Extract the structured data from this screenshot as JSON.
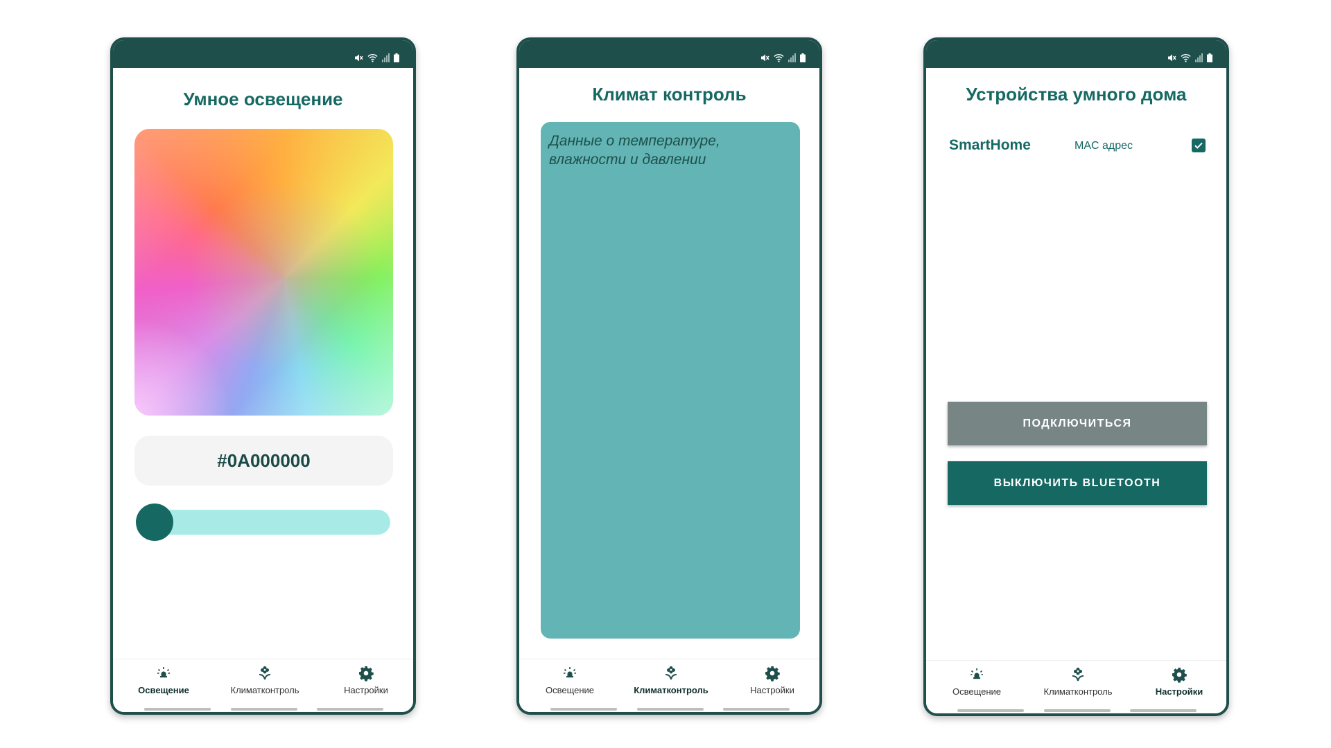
{
  "colors": {
    "primary": "#166963",
    "status_bar": "#1e4f4b",
    "climate_panel": "#62b5b4",
    "slider_track": "#a8ebe6",
    "connect_button": "#778584"
  },
  "nav": {
    "items": [
      {
        "label": "Освещение",
        "icon": "bulb-icon"
      },
      {
        "label": "Климатконтроль",
        "icon": "flower-icon"
      },
      {
        "label": "Настройки",
        "icon": "gear-icon"
      }
    ]
  },
  "lighting": {
    "title": "Умное освещение",
    "hex_value": "#0A000000",
    "brightness": 0,
    "active_tab": 0
  },
  "climate": {
    "title": "Климат контроль",
    "panel_text": "Данные о температуре,\nвлажности и давлении",
    "active_tab": 1
  },
  "settings": {
    "title": "Устройства умного дома",
    "device": {
      "name": "SmartHome",
      "mac_label": "MAC адрес",
      "checked": true
    },
    "connect_label": "ПОДКЛЮЧИТЬСЯ",
    "bluetooth_off_label": "ВЫКЛЮЧИТЬ BLUETOOTH",
    "active_tab": 2
  }
}
